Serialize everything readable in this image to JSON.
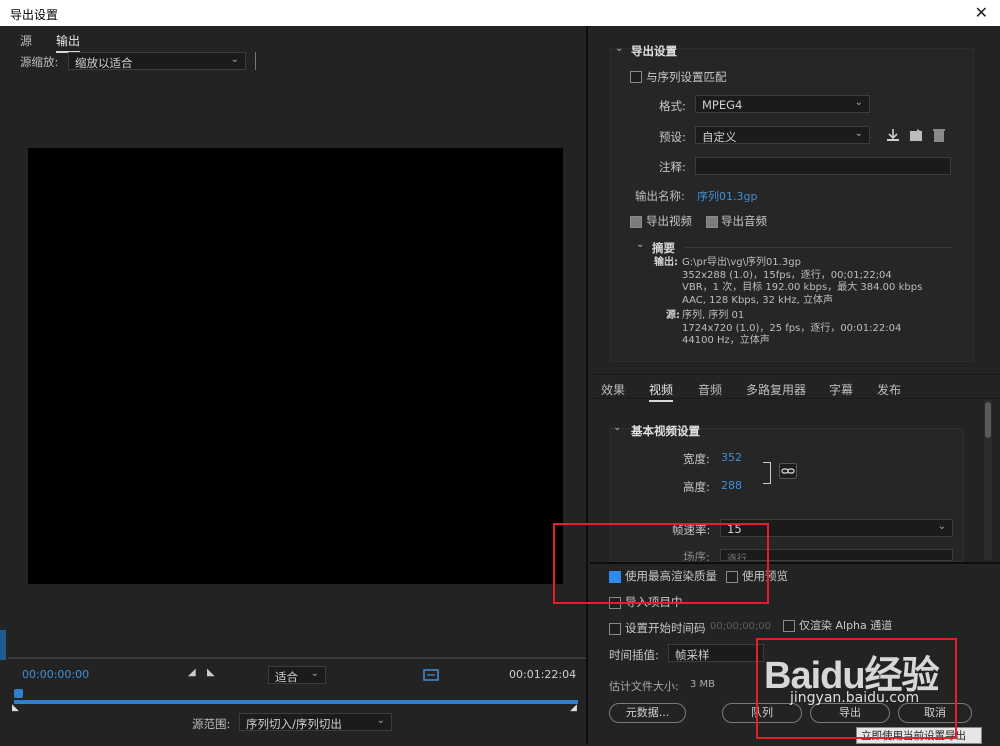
{
  "window": {
    "title": "导出设置",
    "close_glyph": "✕"
  },
  "left": {
    "tabs": [
      "源",
      "输出"
    ],
    "zoom_label": "源缩放:",
    "zoom_value": "缩放以适合",
    "timecode_start": "00:00:00:00",
    "fit_value": "适合",
    "timecode_end": "00:01:22:04",
    "source_range_label": "源范围:",
    "source_range_value": "序列切入/序列切出"
  },
  "export": {
    "section_title": "导出设置",
    "match_sequence": "与序列设置匹配",
    "format_label": "格式:",
    "format_value": "MPEG4",
    "preset_label": "预设:",
    "preset_value": "自定义",
    "notes_label": "注释:",
    "output_name_label": "输出名称:",
    "output_name_value": "序列01.3gp",
    "export_video": "导出视频",
    "export_audio": "导出音频",
    "summary_title": "摘要",
    "output_label": "输出:",
    "output_lines": [
      "G:\\pr导出\\vg\\序列01.3gp",
      "352x288 (1.0)，15fps，逐行，00;01;22;04",
      "VBR，1 次，目标 192.00 kbps，最大 384.00 kbps",
      "AAC, 128 Kbps, 32  kHz, 立体声"
    ],
    "source_label": "源:",
    "source_lines": [
      "序列, 序列 01",
      "1724x720 (1.0)，25 fps，逐行，00:01:22:04",
      "44100 Hz，立体声"
    ]
  },
  "right_tabs": [
    "效果",
    "视频",
    "音频",
    "多路复用器",
    "字幕",
    "发布"
  ],
  "video": {
    "section_title": "基本视频设置",
    "width_label": "宽度:",
    "width_value": "352",
    "height_label": "高度:",
    "height_value": "288",
    "framerate_label": "帧速率:",
    "framerate_value": "15",
    "field_label": "场序:",
    "field_value": "逐行"
  },
  "bottom": {
    "max_quality": "使用最高渲染质量",
    "use_preview": "使用预览",
    "import_project": "导入项目中",
    "set_start_tc": "设置开始时间码",
    "start_tc_value": "00;00;00;00",
    "render_alpha": "仅渲染 Alpha 通道",
    "time_interp_label": "时间插值:",
    "time_interp_value": "帧采样",
    "est_size_label": "估计文件大小:",
    "est_size_value": "3 MB",
    "metadata_btn": "元数据...",
    "queue_btn": "队列",
    "export_btn": "导出",
    "cancel_btn": "取消",
    "tooltip": "立即使用当前设置导出"
  },
  "watermark": {
    "logo": "Baidu经验",
    "url": "jingyan.baidu.com"
  },
  "colors": {
    "accent": "#3f8fd6",
    "highlight": "#e41e2a",
    "checkbox_blue": "#2d8ceb"
  }
}
